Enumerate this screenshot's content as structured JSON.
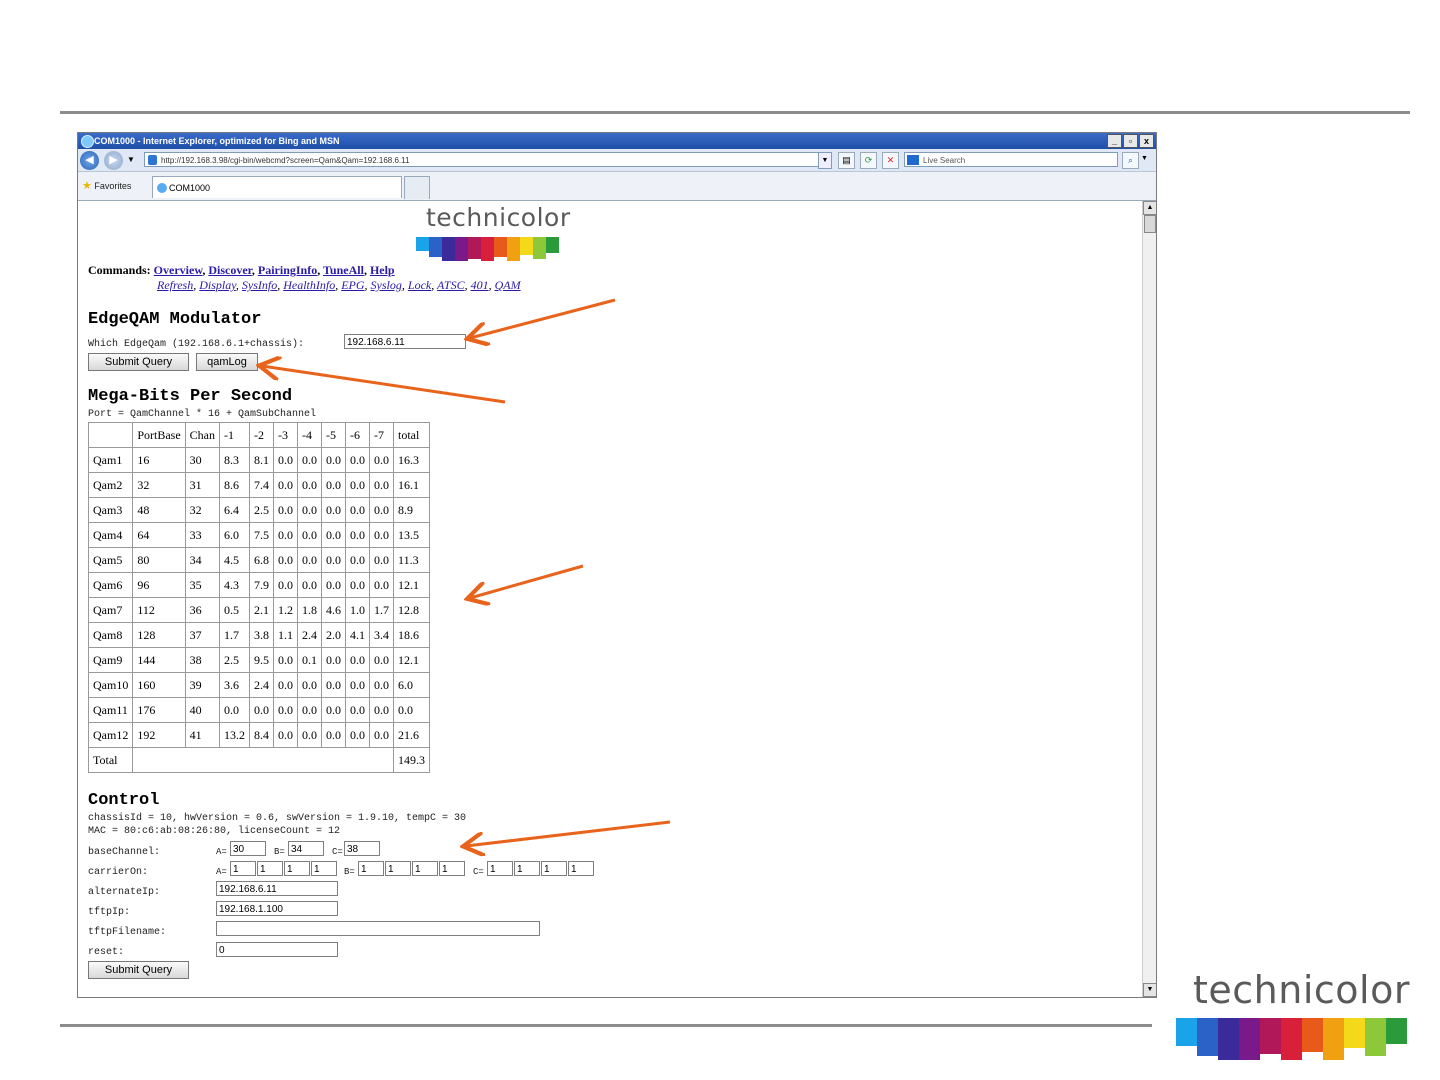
{
  "browser": {
    "title": "COM1000 - Internet Explorer, optimized for Bing and MSN",
    "url": "http://192.168.3.98/cgi-bin/webcmd?screen=Qam&Qam=192.168.6.11",
    "search_placeholder": "Live Search",
    "favorites_label": "Favorites",
    "tab_title": "COM1000",
    "window_buttons": [
      "_",
      "▫",
      "x"
    ]
  },
  "page": {
    "logo_text": "technicolor",
    "commands_label": "Commands:",
    "commands": [
      "Overview",
      "Discover",
      "PairingInfo",
      "TuneAll",
      "Help"
    ],
    "commands2": [
      "Refresh",
      "Display",
      "SysInfo",
      "HealthInfo",
      "EPG",
      "Syslog",
      "Lock",
      "ATSC",
      "401",
      "QAM"
    ],
    "edgeqam": {
      "heading": "EdgeQAM Modulator",
      "which_label": "Which EdgeQam (192.168.6.1+chassis):",
      "which_value": "192.168.6.11",
      "submit_label": "Submit Query",
      "qamlog_label": "qamLog"
    },
    "mbps": {
      "heading": "Mega-Bits Per Second",
      "subtitle": "Port = QamChannel * 16 + QamSubChannel",
      "columns": [
        "",
        "PortBase",
        "Chan",
        "-1",
        "-2",
        "-3",
        "-4",
        "-5",
        "-6",
        "-7",
        "total"
      ],
      "rows": [
        [
          "Qam1",
          "16",
          "30",
          "8.3",
          "8.1",
          "0.0",
          "0.0",
          "0.0",
          "0.0",
          "0.0",
          "16.3"
        ],
        [
          "Qam2",
          "32",
          "31",
          "8.6",
          "7.4",
          "0.0",
          "0.0",
          "0.0",
          "0.0",
          "0.0",
          "16.1"
        ],
        [
          "Qam3",
          "48",
          "32",
          "6.4",
          "2.5",
          "0.0",
          "0.0",
          "0.0",
          "0.0",
          "0.0",
          "8.9"
        ],
        [
          "Qam4",
          "64",
          "33",
          "6.0",
          "7.5",
          "0.0",
          "0.0",
          "0.0",
          "0.0",
          "0.0",
          "13.5"
        ],
        [
          "Qam5",
          "80",
          "34",
          "4.5",
          "6.8",
          "0.0",
          "0.0",
          "0.0",
          "0.0",
          "0.0",
          "11.3"
        ],
        [
          "Qam6",
          "96",
          "35",
          "4.3",
          "7.9",
          "0.0",
          "0.0",
          "0.0",
          "0.0",
          "0.0",
          "12.1"
        ],
        [
          "Qam7",
          "112",
          "36",
          "0.5",
          "2.1",
          "1.2",
          "1.8",
          "4.6",
          "1.0",
          "1.7",
          "12.8"
        ],
        [
          "Qam8",
          "128",
          "37",
          "1.7",
          "3.8",
          "1.1",
          "2.4",
          "2.0",
          "4.1",
          "3.4",
          "18.6"
        ],
        [
          "Qam9",
          "144",
          "38",
          "2.5",
          "9.5",
          "0.0",
          "0.1",
          "0.0",
          "0.0",
          "0.0",
          "12.1"
        ],
        [
          "Qam10",
          "160",
          "39",
          "3.6",
          "2.4",
          "0.0",
          "0.0",
          "0.0",
          "0.0",
          "0.0",
          "6.0"
        ],
        [
          "Qam11",
          "176",
          "40",
          "0.0",
          "0.0",
          "0.0",
          "0.0",
          "0.0",
          "0.0",
          "0.0",
          "0.0"
        ],
        [
          "Qam12",
          "192",
          "41",
          "13.2",
          "8.4",
          "0.0",
          "0.0",
          "0.0",
          "0.0",
          "0.0",
          "21.6"
        ]
      ],
      "total_label": "Total",
      "total_value": "149.3"
    },
    "control": {
      "heading": "Control",
      "info1": "chassisId = 10, hwVersion = 0.6, swVersion = 1.9.10, tempC = 30",
      "info2": "MAC = 80:c6:ab:08:26:80, licenseCount = 12",
      "basechannel_label": "baseChannel:",
      "basechannel": [
        {
          "prefix": "A=",
          "value": "30"
        },
        {
          "prefix": "B=",
          "value": "34"
        },
        {
          "prefix": "C=",
          "value": "38"
        }
      ],
      "carrieron_label": "carrierOn:",
      "carrieron": [
        {
          "prefix": "A=",
          "values": [
            "1",
            "1",
            "1",
            "1"
          ]
        },
        {
          "prefix": "B=",
          "values": [
            "1",
            "1",
            "1",
            "1"
          ]
        },
        {
          "prefix": "C=",
          "values": [
            "1",
            "1",
            "1",
            "1"
          ]
        }
      ],
      "alternateip_label": "alternateIp:",
      "alternateip_value": "192.168.6.11",
      "tftpip_label": "tftpIp:",
      "tftpip_value": "192.168.1.100",
      "tftpfilename_label": "tftpFilename:",
      "tftpfilename_value": "",
      "reset_label": "reset:",
      "reset_value": "0",
      "submit_label": "Submit Query"
    }
  },
  "slide_logo_text": "technicolor",
  "colors": {
    "arrow": "#e8641c",
    "link": "#2a1aa8",
    "rule": "#8c8c8c",
    "logo_bars": [
      "#1aa3e8",
      "#2a62c8",
      "#3a2a9a",
      "#7a1a8a",
      "#b0185a",
      "#d8203a",
      "#e85a1a",
      "#f0a010",
      "#f4d81a",
      "#8cc83a",
      "#2a9a3a"
    ]
  }
}
